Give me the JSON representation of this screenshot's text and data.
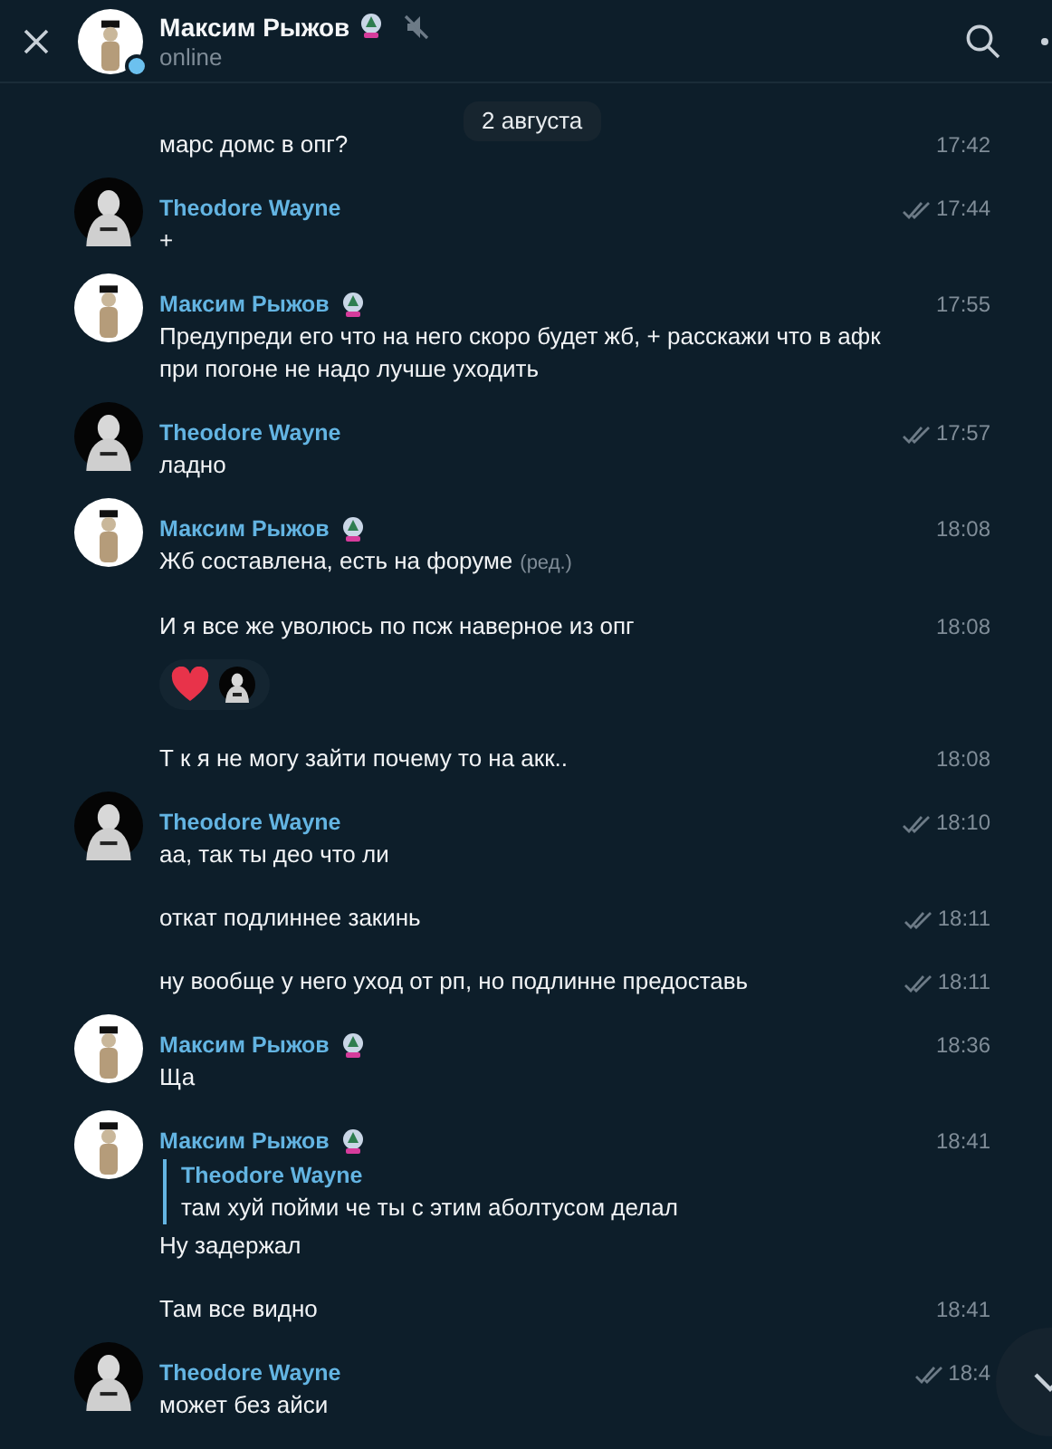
{
  "header": {
    "title": "Максим Рыжов",
    "status": "online",
    "online": true,
    "muted": true,
    "badge": true
  },
  "date_badge": "2 августа",
  "groups": [
    {
      "messages": [
        {
          "text": "марс домс в опг?",
          "time": "17:42"
        }
      ]
    },
    {
      "author": "Theodore Wayne",
      "outgoing": true,
      "messages": [
        {
          "text": "+",
          "time": "17:44",
          "read": true
        }
      ]
    },
    {
      "author": "Максим Рыжов",
      "outgoing": false,
      "badge": true,
      "messages": [
        {
          "text": "Предупреди его что на него скоро будет жб, + расскажи что в афк при погоне не надо лучше уходить",
          "time": "17:55"
        }
      ]
    },
    {
      "author": "Theodore Wayne",
      "outgoing": true,
      "messages": [
        {
          "text": "ладно",
          "time": "17:57",
          "read": true
        }
      ]
    },
    {
      "author": "Максим Рыжов",
      "outgoing": false,
      "badge": true,
      "messages": [
        {
          "text": "Жб составлена, есть на форуме",
          "edited_label": "(ред.)",
          "time": "18:08"
        },
        {
          "text": "И я все же уволюсь по псж наверное из опг",
          "time": "18:08",
          "reactions": [
            {
              "kind": "heart"
            },
            {
              "kind": "avatar"
            }
          ]
        },
        {
          "text": "Т к я не могу зайти почему то на акк..",
          "time": "18:08"
        }
      ]
    },
    {
      "author": "Theodore Wayne",
      "outgoing": true,
      "messages": [
        {
          "text": "аа, так ты део что ли",
          "time": "18:10",
          "read": true
        },
        {
          "text": "откат подлиннее закинь",
          "time": "18:11",
          "read": true
        },
        {
          "text": "ну вообще у него уход от рп, но подлинне предоставь",
          "time": "18:11",
          "read": true
        }
      ]
    },
    {
      "author": "Максим Рыжов",
      "outgoing": false,
      "badge": true,
      "messages": [
        {
          "text": "Ща",
          "time": "18:36"
        }
      ]
    },
    {
      "author": "Максим Рыжов",
      "outgoing": false,
      "badge": true,
      "messages": [
        {
          "text": "Ну задержал",
          "time": "18:41",
          "reply": {
            "author": "Theodore Wayne",
            "text": "там хуй пойми че ты с этим аболтусом делал"
          }
        },
        {
          "text": "Там все видно",
          "time": "18:41"
        }
      ]
    },
    {
      "author": "Theodore Wayne",
      "outgoing": true,
      "messages": [
        {
          "text": "может без айси",
          "time": "18:4",
          "read": true
        }
      ]
    }
  ]
}
